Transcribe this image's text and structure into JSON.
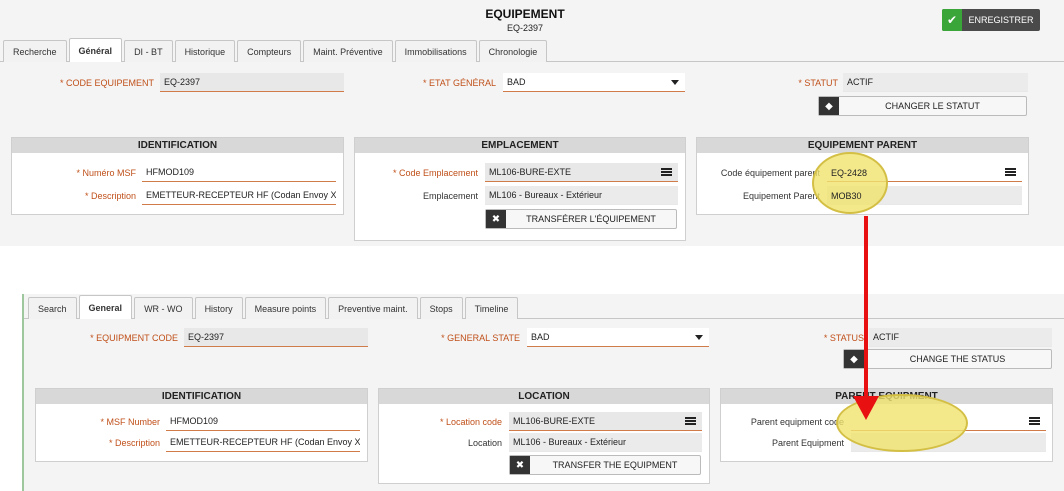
{
  "fr": {
    "title": "EQUIPEMENT",
    "subtitle": "EQ-2397",
    "save_label": "ENREGISTRER",
    "tabs": [
      "Recherche",
      "Général",
      "DI - BT",
      "Historique",
      "Compteurs",
      "Maint. Préventive",
      "Immobilisations",
      "Chronologie"
    ],
    "code_label": "CODE EQUIPEMENT",
    "code_value": "EQ-2397",
    "state_label": "ETAT GÉNÉRAL",
    "state_value": "BAD",
    "status_label": "STATUT",
    "status_value": "ACTIF",
    "change_status": "CHANGER LE STATUT",
    "ident_title": "IDENTIFICATION",
    "msf_label": "Numéro MSF",
    "msf_value": "HFMOD109",
    "desc_label": "Description",
    "desc_value": "EMETTEUR-RECEPTEUR HF (Codan Envoy X",
    "loc_title": "EMPLACEMENT",
    "loc_code_label": "Code Emplacement",
    "loc_code_value": "ML106-BURE-EXTE",
    "loc_label": "Emplacement",
    "loc_value": "ML106 - Bureaux - Extérieur",
    "transfer": "TRANSFÉRER L'ÉQUIPEMENT",
    "parent_title": "EQUIPEMENT PARENT",
    "parent_code_label": "Code équipement parent",
    "parent_code_value": "EQ-2428",
    "parent_label": "Equipement Parent",
    "parent_value": "MOB30"
  },
  "en": {
    "tabs": [
      "Search",
      "General",
      "WR - WO",
      "History",
      "Measure points",
      "Preventive maint.",
      "Stops",
      "Timeline"
    ],
    "code_label": "EQUIPMENT CODE",
    "code_value": "EQ-2397",
    "state_label": "GENERAL STATE",
    "state_value": "BAD",
    "status_label": "STATUS",
    "status_value": "ACTIF",
    "change_status": "CHANGE THE STATUS",
    "ident_title": "IDENTIFICATION",
    "msf_label": "MSF Number",
    "msf_value": "HFMOD109",
    "desc_label": "Description",
    "desc_value": "EMETTEUR-RECEPTEUR HF (Codan Envoy X",
    "loc_title": "LOCATION",
    "loc_code_label": "Location code",
    "loc_code_value": "ML106-BURE-EXTE",
    "loc_label": "Location",
    "loc_value": "ML106 - Bureaux - Extérieur",
    "transfer": "TRANSFER THE EQUIPMENT",
    "parent_title": "PARENT EQUIPMENT",
    "parent_code_label": "Parent equipment code",
    "parent_code_value": "",
    "parent_label": "Parent Equipment",
    "parent_value": ""
  },
  "colors": {
    "highlight": "#f0e46e",
    "arrow": "#e81010",
    "required": "#c0501a",
    "save_check": "#3aa63a"
  }
}
